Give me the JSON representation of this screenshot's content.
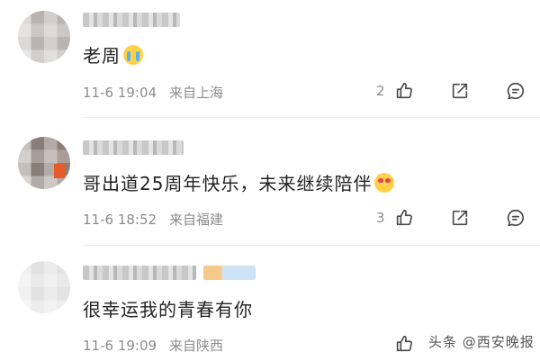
{
  "comments": [
    {
      "text": "老周",
      "emoji": "crying-face",
      "time": "11-6 19:04",
      "location": "来自上海",
      "likes": "2"
    },
    {
      "text": "哥出道25周年快乐，未来继续陪伴",
      "emoji": "smiling-face-with-hearts",
      "time": "11-6 18:52",
      "location": "来自福建",
      "likes": "3"
    },
    {
      "text": "很幸运我的青春有你",
      "emoji": "",
      "time": "11-6 19:09",
      "location": "来自陕西",
      "likes": ""
    }
  ],
  "watermark": "头条 @西安晚报",
  "icons": {
    "like": "thumbs-up-icon",
    "share": "share-icon",
    "comment": "comment-icon"
  },
  "colors": {
    "text": "#222222",
    "meta": "#8c8c8c",
    "icon": "#4a4a4a"
  }
}
